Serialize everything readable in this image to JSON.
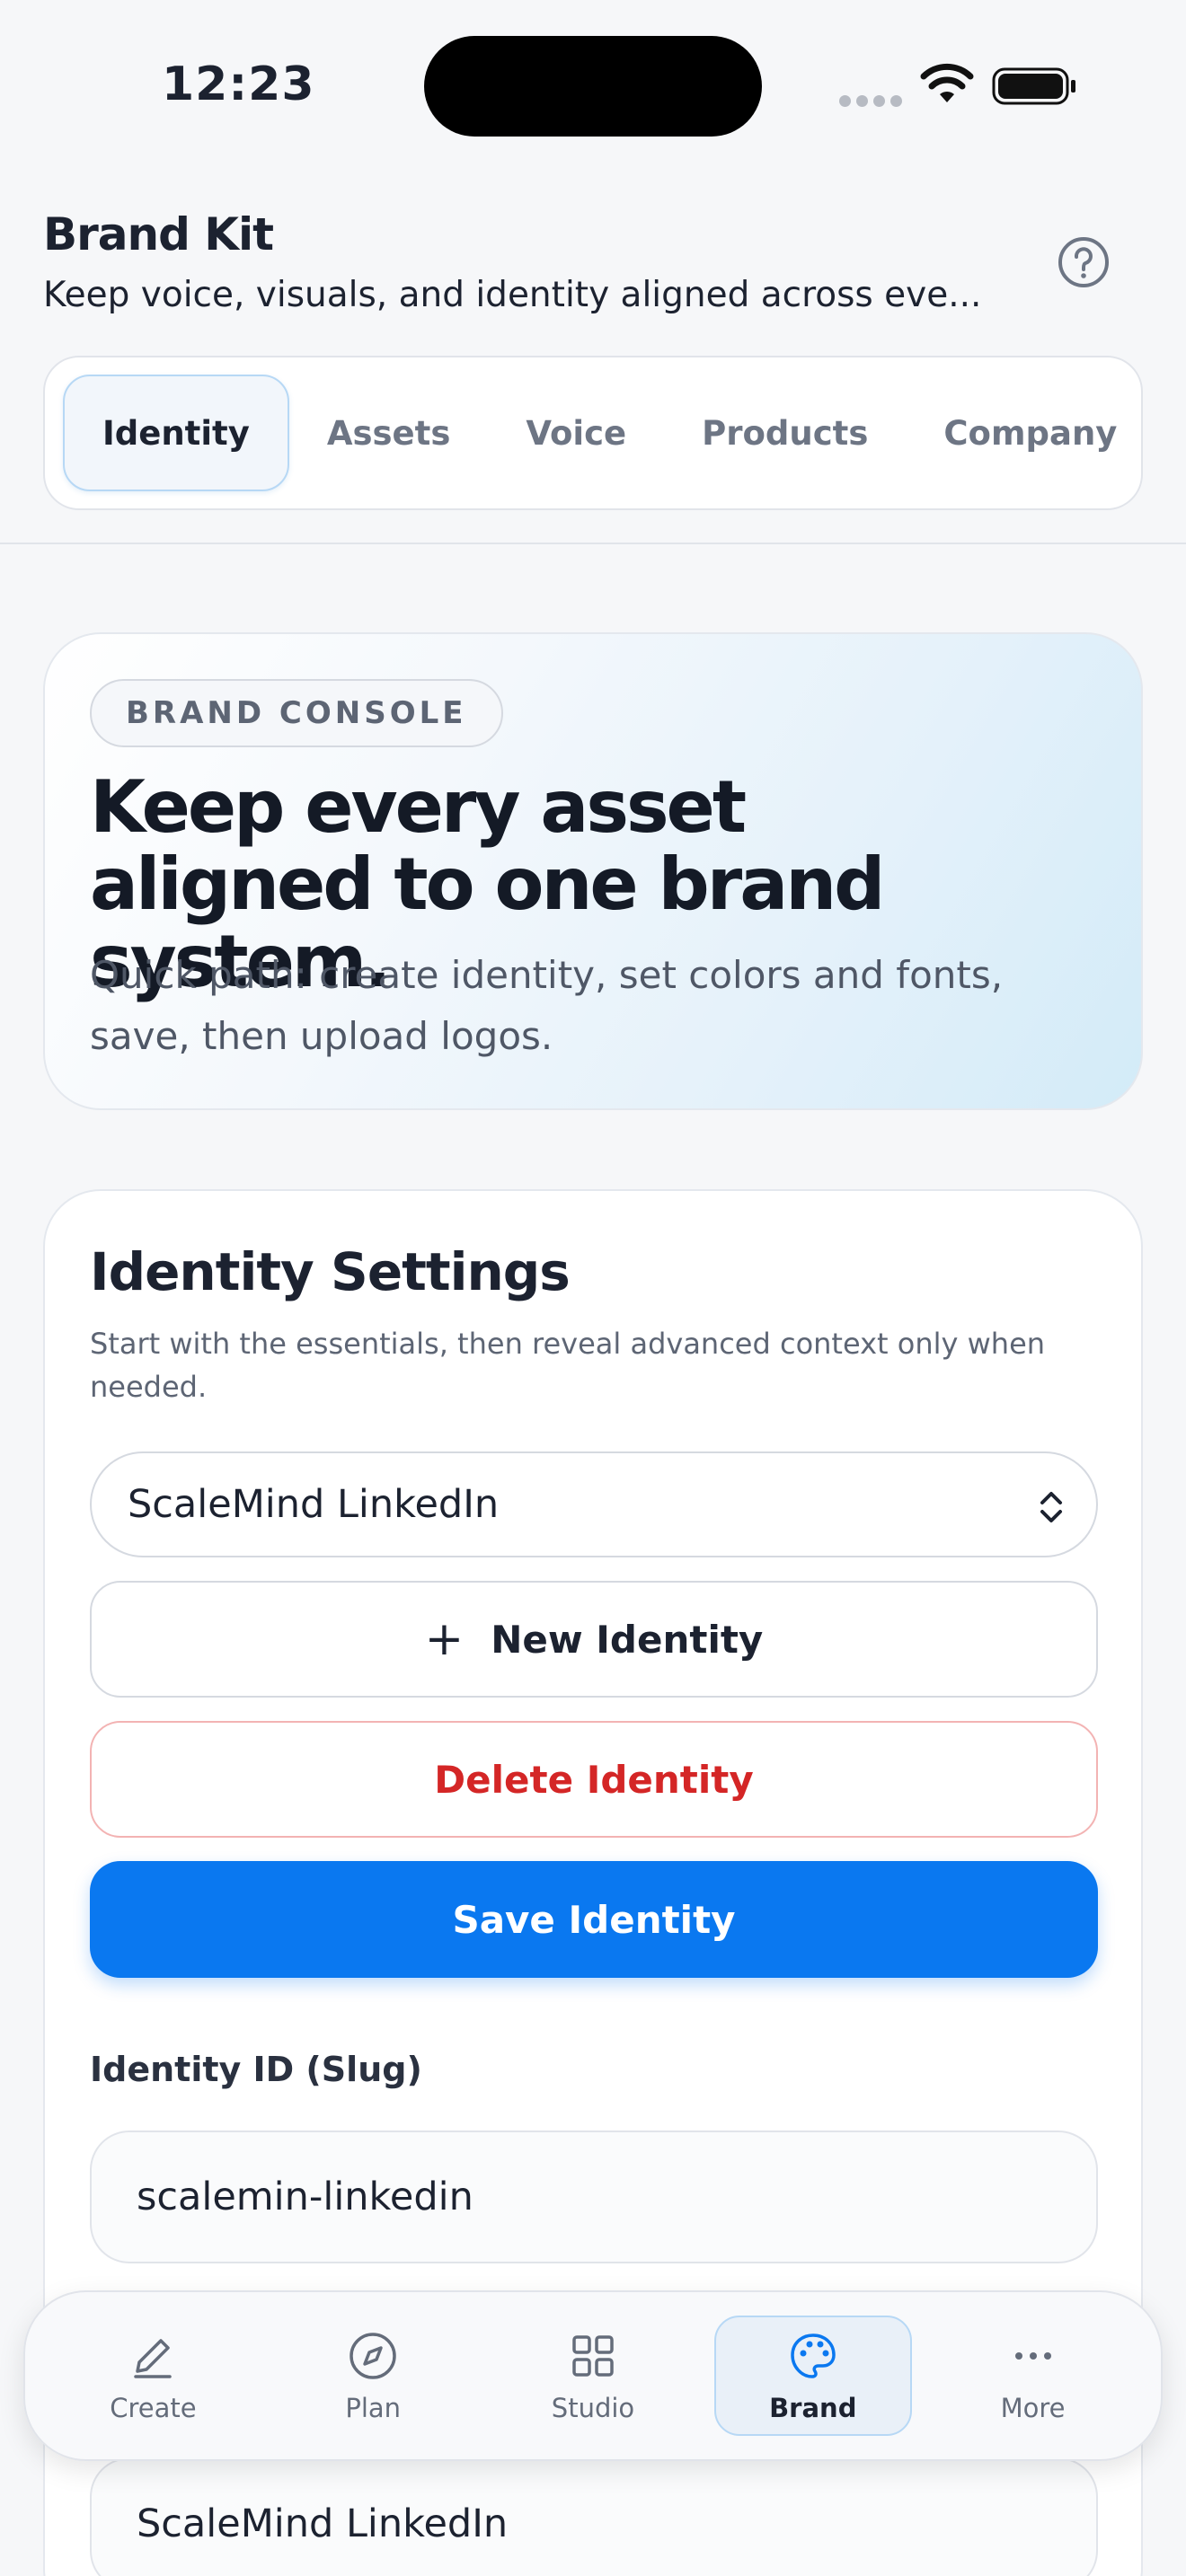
{
  "status": {
    "time": "12:23"
  },
  "header": {
    "title": "Brand Kit",
    "subtitle": "Keep voice, visuals, and identity aligned across eve..."
  },
  "tabs": [
    {
      "label": "Identity",
      "active": true
    },
    {
      "label": "Assets",
      "active": false
    },
    {
      "label": "Voice",
      "active": false
    },
    {
      "label": "Products",
      "active": false
    },
    {
      "label": "Company",
      "active": false
    }
  ],
  "hero": {
    "badge": "BRAND CONSOLE",
    "title": "Keep every asset aligned to one brand system.",
    "description": "Quick path: create identity, set colors and fonts, save, then upload logos."
  },
  "identity_settings": {
    "title": "Identity Settings",
    "description": "Start with the essentials, then reveal advanced context only when needed.",
    "selected_identity": "ScaleMind LinkedIn",
    "new_button": "New Identity",
    "delete_button": "Delete Identity",
    "save_button": "Save Identity",
    "slug_label": "Identity ID (Slug)",
    "slug_value": "scalemin-linkedin",
    "name_value": "ScaleMind LinkedIn"
  },
  "bottom_nav": [
    {
      "label": "Create",
      "icon": "pencil-icon",
      "active": false
    },
    {
      "label": "Plan",
      "icon": "compass-icon",
      "active": false
    },
    {
      "label": "Studio",
      "icon": "grid-icon",
      "active": false
    },
    {
      "label": "Brand",
      "icon": "palette-icon",
      "active": true
    },
    {
      "label": "More",
      "icon": "more-icon",
      "active": false
    }
  ],
  "colors": {
    "primary": "#0a78f0",
    "danger": "#d42626",
    "active_tab_border": "#b7d8f5"
  }
}
